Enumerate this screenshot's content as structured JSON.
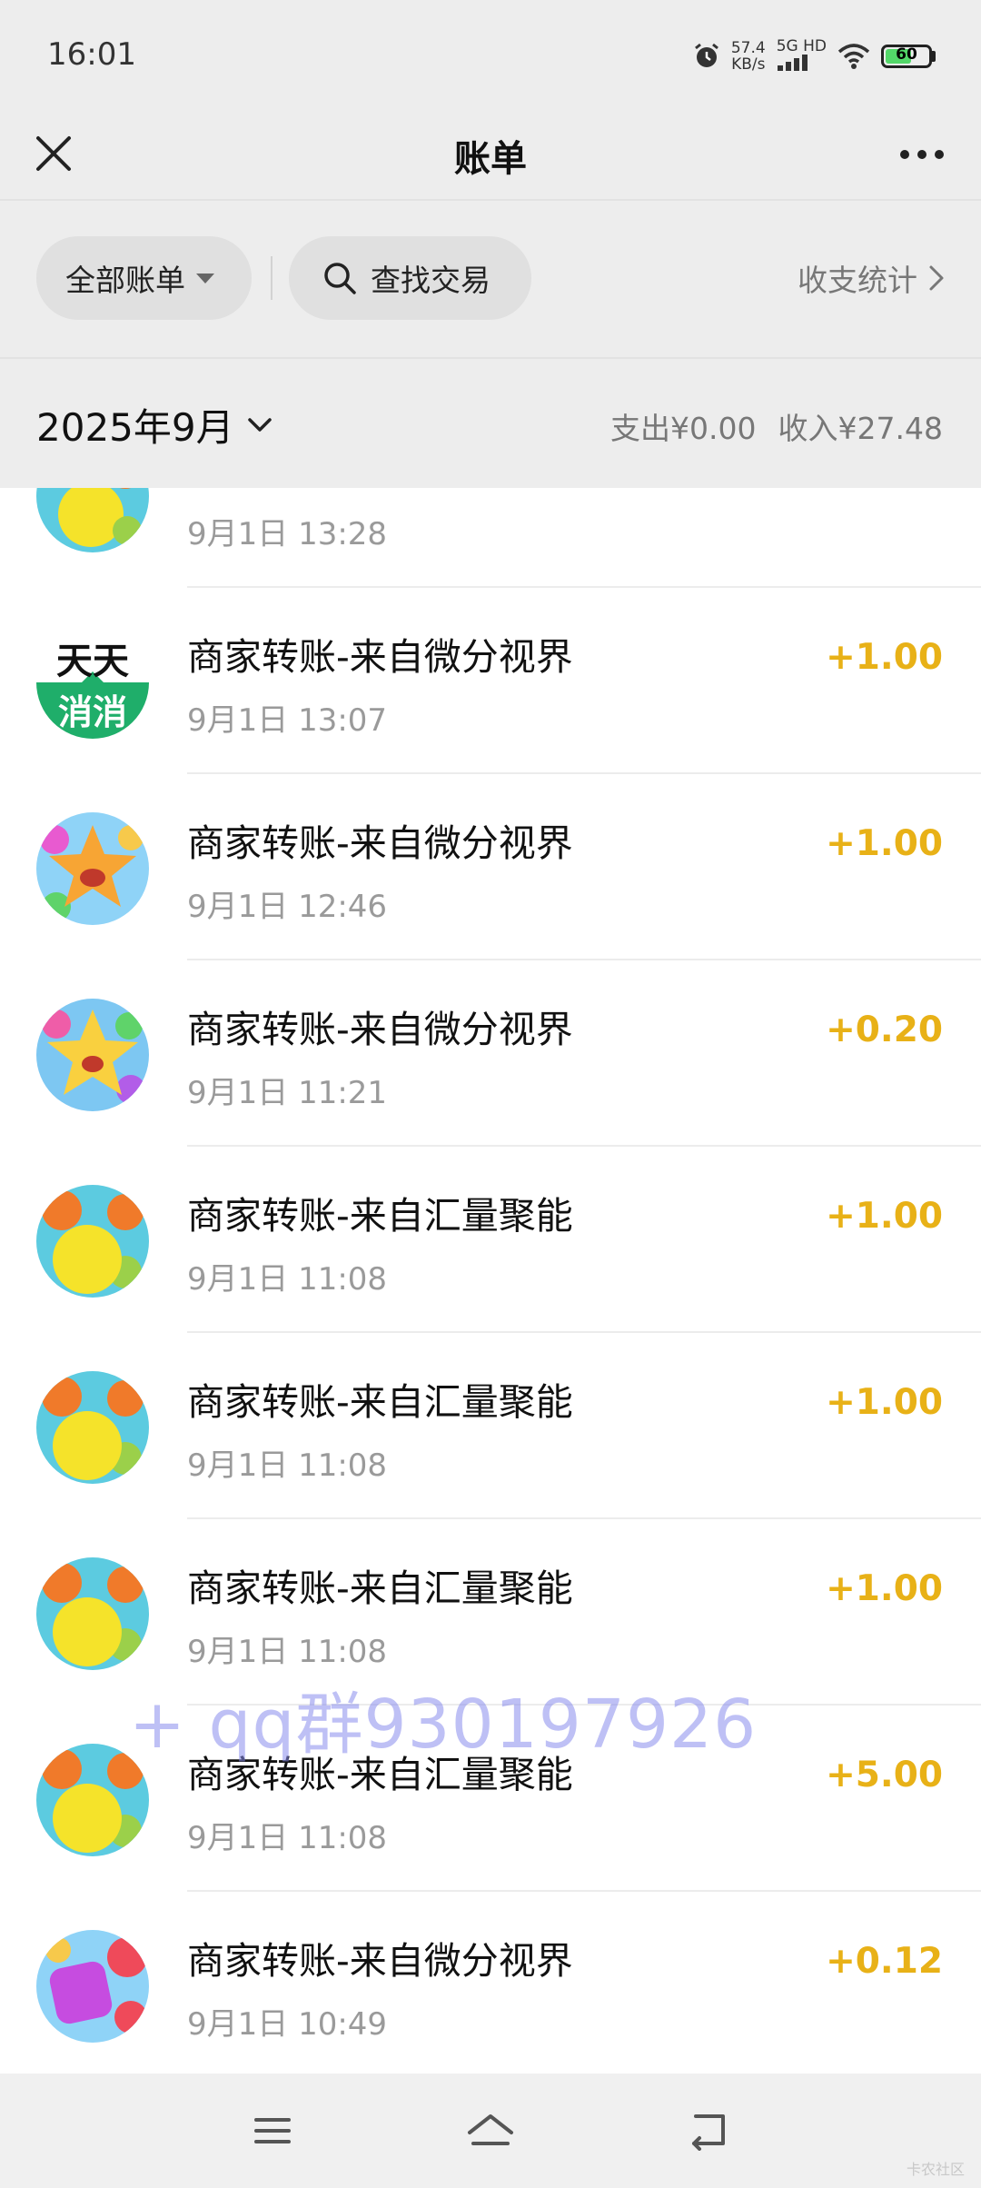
{
  "status_bar": {
    "time": "16:01",
    "speed_value": "57.4",
    "speed_unit": "KB/s",
    "network": "5G HD",
    "battery": "60",
    "battery_level": 0.6
  },
  "nav": {
    "title": "账单",
    "close_icon": "close-icon",
    "more_icon": "more-icon"
  },
  "filter": {
    "all_bills": "全部账单",
    "search": "查找交易",
    "stats": "收支统计"
  },
  "month": {
    "label": "2025年9月",
    "expense": "支出¥0.00",
    "income": "收入¥27.48"
  },
  "transactions": [
    {
      "title": "",
      "time": "9月1日 13:28",
      "amount": "",
      "avatar": "fruit-game-icon"
    },
    {
      "title": "商家转账-来自微分视界",
      "time": "9月1日 13:07",
      "amount": "+1.00",
      "avatar": "tiantian-xiaoxiao-logo",
      "avatar_text_top": "天天",
      "avatar_text_bottom": "消消"
    },
    {
      "title": "商家转账-来自微分视界",
      "time": "9月1日 12:46",
      "amount": "+1.00",
      "avatar": "star-character-icon"
    },
    {
      "title": "商家转账-来自微分视界",
      "time": "9月1日 11:21",
      "amount": "+0.20",
      "avatar": "star-character-icon"
    },
    {
      "title": "商家转账-来自汇量聚能",
      "time": "9月1日 11:08",
      "amount": "+1.00",
      "avatar": "fruit-game-icon"
    },
    {
      "title": "商家转账-来自汇量聚能",
      "time": "9月1日 11:08",
      "amount": "+1.00",
      "avatar": "fruit-game-icon"
    },
    {
      "title": "商家转账-来自汇量聚能",
      "time": "9月1日 11:08",
      "amount": "+1.00",
      "avatar": "fruit-game-icon"
    },
    {
      "title": "商家转账-来自汇量聚能",
      "time": "9月1日 11:08",
      "amount": "+5.00",
      "avatar": "fruit-game-icon"
    },
    {
      "title": "商家转账-来自微分视界",
      "time": "9月1日 10:49",
      "amount": "+0.12",
      "avatar": "candy-game-icon"
    }
  ],
  "watermark": "+ qq群930197926",
  "corner_mark": "卡农社区",
  "colors": {
    "amount": "#e8b117",
    "background": "#ededed",
    "list_background": "#ffffff"
  }
}
